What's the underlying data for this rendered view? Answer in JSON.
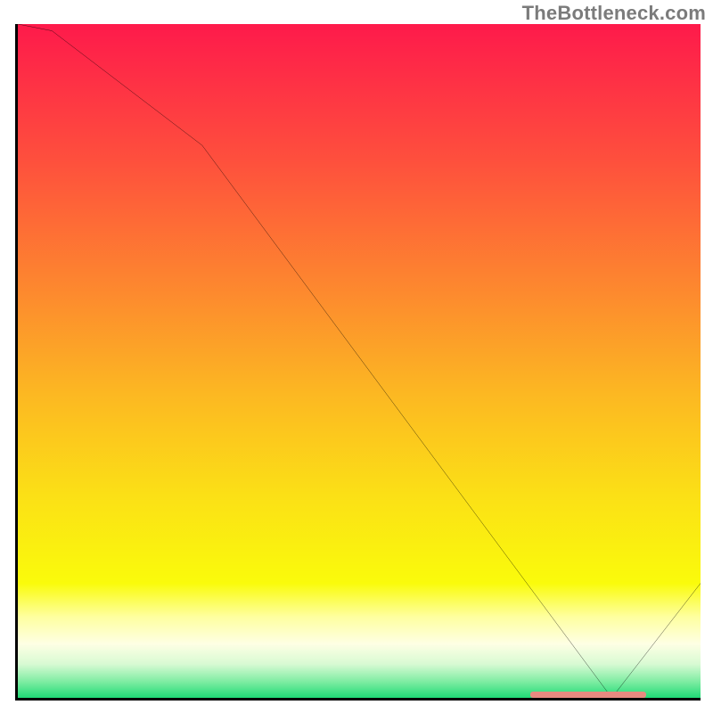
{
  "watermark": "TheBottleneck.com",
  "chart_data": {
    "type": "line",
    "title": "",
    "xlabel": "",
    "ylabel": "",
    "xlim": [
      0,
      100
    ],
    "ylim": [
      0,
      100
    ],
    "x": [
      0,
      5,
      27,
      87,
      100
    ],
    "y": [
      100,
      99,
      82,
      0,
      17
    ],
    "marker_band": {
      "x_start": 75,
      "x_end": 92
    },
    "background": {
      "type": "vertical_gradient",
      "stops": [
        {
          "pos": 0.0,
          "color": "#fe1a4b"
        },
        {
          "pos": 0.2,
          "color": "#fe4f3d"
        },
        {
          "pos": 0.4,
          "color": "#fd8a2e"
        },
        {
          "pos": 0.55,
          "color": "#fcb822"
        },
        {
          "pos": 0.7,
          "color": "#fbe016"
        },
        {
          "pos": 0.83,
          "color": "#fafb0b"
        },
        {
          "pos": 0.88,
          "color": "#feffa0"
        },
        {
          "pos": 0.92,
          "color": "#feffe4"
        },
        {
          "pos": 0.95,
          "color": "#d8fad3"
        },
        {
          "pos": 0.975,
          "color": "#82eda4"
        },
        {
          "pos": 1.0,
          "color": "#20db76"
        }
      ]
    }
  }
}
